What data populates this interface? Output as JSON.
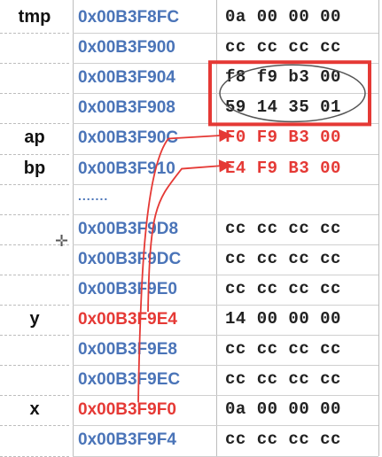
{
  "rows": [
    {
      "label": "tmp",
      "address": "0x00B3F8FC",
      "value": "0a 00 00 00",
      "addr_color": "blue",
      "val_color": "black"
    },
    {
      "label": "",
      "address": "0x00B3F900",
      "value": "cc cc cc cc",
      "addr_color": "blue",
      "val_color": "black"
    },
    {
      "label": "",
      "address": "0x00B3F904",
      "value": "f8 f9 b3 00",
      "addr_color": "blue",
      "val_color": "black"
    },
    {
      "label": "",
      "address": "0x00B3F908",
      "value": "59 14 35 01",
      "addr_color": "blue",
      "val_color": "black"
    },
    {
      "label": "ap",
      "address": "0x00B3F90C",
      "value": "F0 F9 B3 00",
      "addr_color": "blue",
      "val_color": "red"
    },
    {
      "label": "bp",
      "address": "0x00B3F910",
      "value": "E4 F9 B3 00",
      "addr_color": "blue",
      "val_color": "red"
    },
    {
      "label": "",
      "address": ".......",
      "value": "",
      "addr_color": "blue",
      "val_color": "black",
      "ellipsis": true
    },
    {
      "label": "",
      "address": "0x00B3F9D8",
      "value": "cc cc cc cc",
      "addr_color": "blue",
      "val_color": "black"
    },
    {
      "label": "",
      "address": "0x00B3F9DC",
      "value": "cc cc cc cc",
      "addr_color": "blue",
      "val_color": "black"
    },
    {
      "label": "",
      "address": "0x00B3F9E0",
      "value": "cc cc cc cc",
      "addr_color": "blue",
      "val_color": "black"
    },
    {
      "label": "y",
      "address": "0x00B3F9E4",
      "value": "14 00 00 00",
      "addr_color": "red",
      "val_color": "black"
    },
    {
      "label": "",
      "address": "0x00B3F9E8",
      "value": "cc cc cc cc",
      "addr_color": "blue",
      "val_color": "black"
    },
    {
      "label": "",
      "address": "0x00B3F9EC",
      "value": "cc cc cc cc",
      "addr_color": "blue",
      "val_color": "black"
    },
    {
      "label": "x",
      "address": "0x00B3F9F0",
      "value": "0a 00 00 00",
      "addr_color": "red",
      "val_color": "black"
    },
    {
      "label": "",
      "address": "0x00B3F9F4",
      "value": "cc cc cc cc",
      "addr_color": "blue",
      "val_color": "black"
    }
  ],
  "colors": {
    "address_blue": "#4a74b8",
    "highlight_red": "#e53935",
    "text_black": "#222222",
    "grid_gray": "#cfcfcf"
  },
  "annotations": {
    "highlight_box_rows": [
      2,
      3
    ],
    "ellipse_rows": [
      2,
      3
    ],
    "arrows": [
      {
        "from_row": 13,
        "to_row": 4
      },
      {
        "from_row": 10,
        "to_row": 5
      }
    ]
  }
}
